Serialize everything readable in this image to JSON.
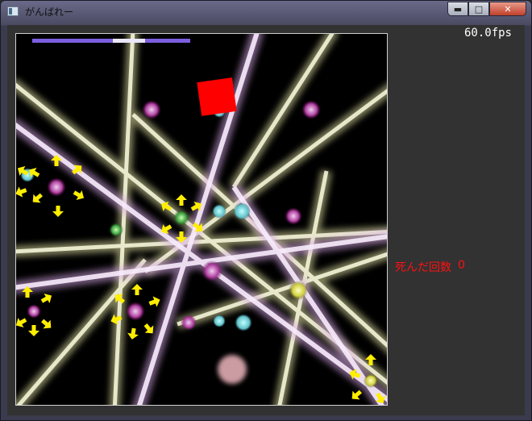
{
  "window": {
    "title": "がんばれー",
    "icon": "app-window-icon"
  },
  "hud": {
    "fps": "60.0fps",
    "deaths_label": "死んだ回数",
    "deaths_value": "0"
  },
  "colors": {
    "laser_white_yellow": "#f0f0c0",
    "laser_pink": "#e8c8f0",
    "health_bar": "#7b5fe0",
    "player_square": "#ff0000",
    "arrow_yellow": "#ffee00"
  }
}
